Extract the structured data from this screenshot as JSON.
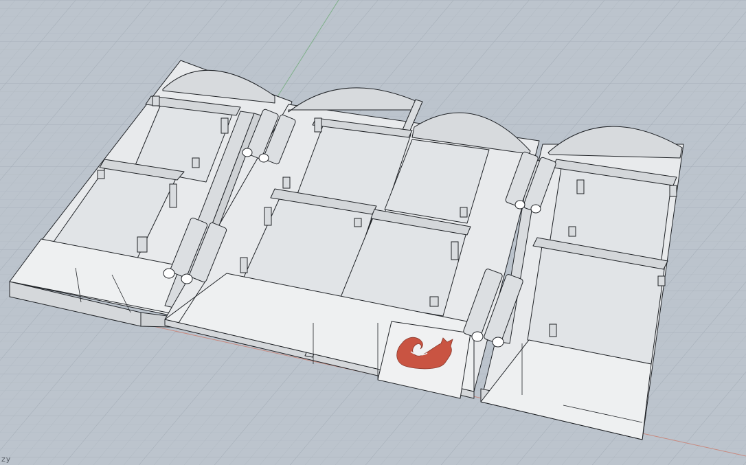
{
  "viewport": {
    "projection_label": "zy",
    "colors": {
      "background": "#bcc4cd",
      "grid_minor": "#adb6bf",
      "grid_major": "#a2abb5",
      "axis_x": "#c88a80",
      "axis_y": "#7fb08a",
      "model_face": "#e6e8ea",
      "model_top": "#eef0f1",
      "model_side": "#d3d6d9",
      "model_edge": "#1f2226",
      "accent_cat": "#c95442"
    },
    "icons": [
      "cat-logo-icon",
      "hinge-icon"
    ]
  }
}
